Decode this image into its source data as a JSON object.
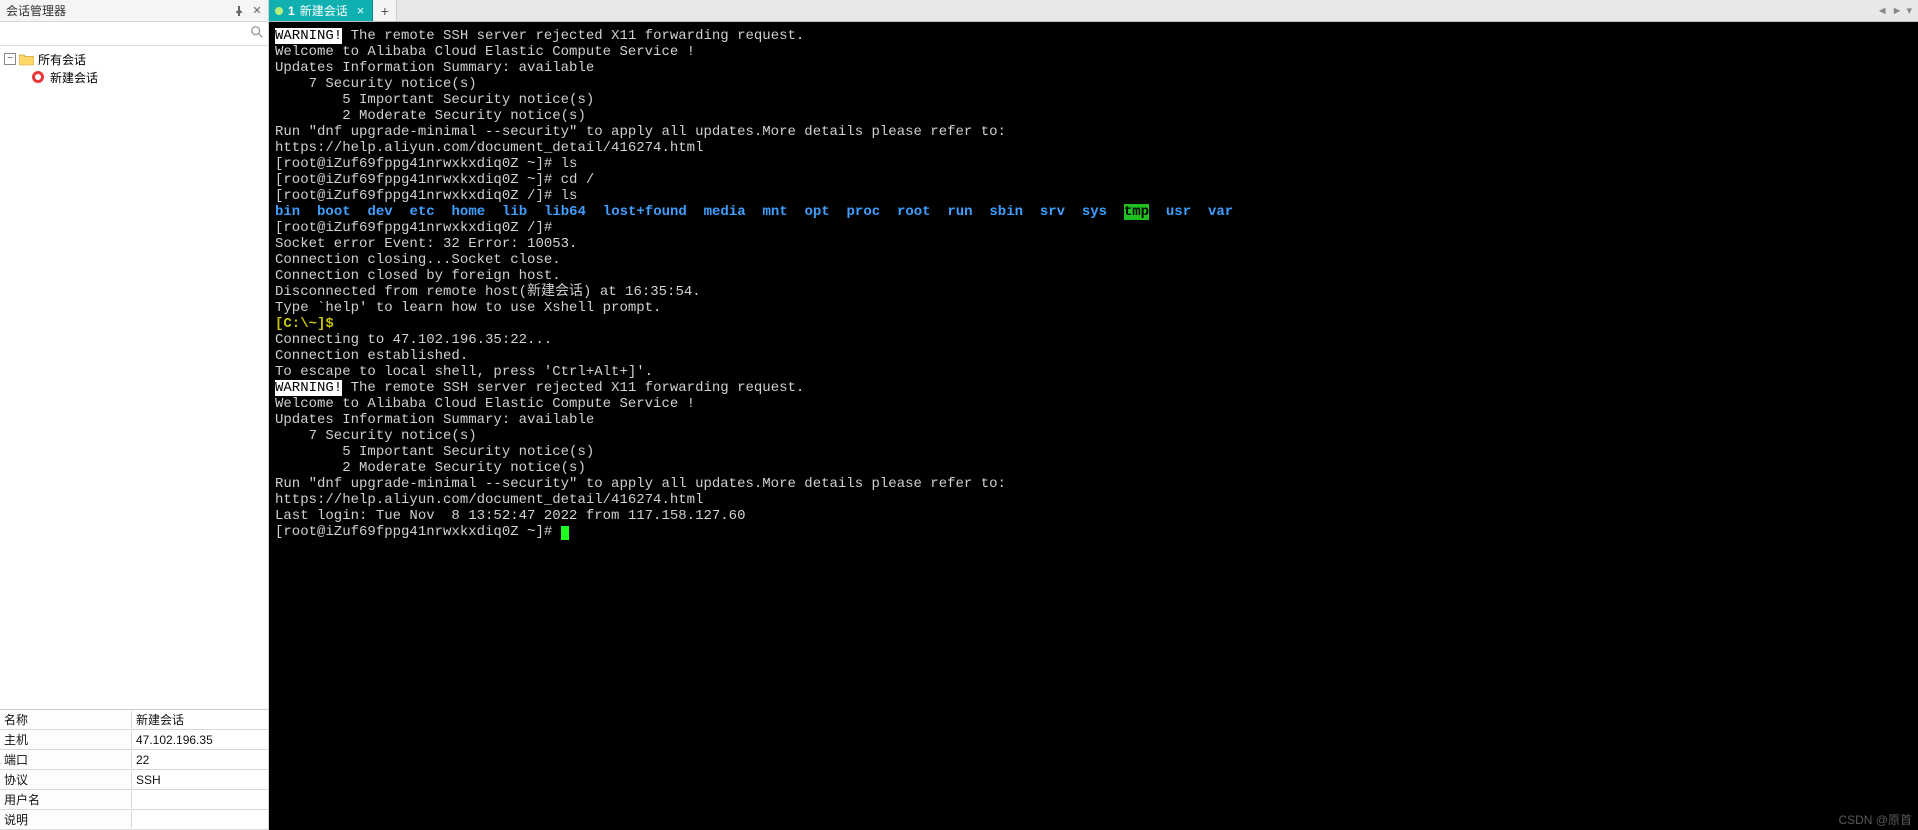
{
  "sidebar": {
    "title": "会话管理器",
    "tree": {
      "root_label": "所有会话",
      "child_label": "新建会话"
    },
    "search_placeholder": ""
  },
  "properties": [
    {
      "key": "名称",
      "val": "新建会话"
    },
    {
      "key": "主机",
      "val": "47.102.196.35"
    },
    {
      "key": "端口",
      "val": "22"
    },
    {
      "key": "协议",
      "val": "SSH"
    },
    {
      "key": "用户名",
      "val": ""
    },
    {
      "key": "说明",
      "val": ""
    }
  ],
  "tabs": {
    "active": {
      "index": "1",
      "label": "新建会话"
    }
  },
  "terminal": {
    "warning_badge": "WARNING!",
    "warning_text": " The remote SSH server rejected X11 forwarding request.",
    "welcome": "Welcome to Alibaba Cloud Elastic Compute Service !",
    "updates_header": "Updates Information Summary: available",
    "updates_l1": "    7 Security notice(s)",
    "updates_l2": "        5 Important Security notice(s)",
    "updates_l3": "        2 Moderate Security notice(s)",
    "run_line": "Run \"dnf upgrade-minimal --security\" to apply all updates.More details please refer to:",
    "help_url": "https://help.aliyun.com/document_detail/416274.html",
    "prompt_home": "[root@iZuf69fppg41nrwxkxdiq0Z ~]#",
    "prompt_root": "[root@iZuf69fppg41nrwxkxdiq0Z /]#",
    "cmd_ls": "ls",
    "cmd_cd": "cd /",
    "dirs_blue_pre": [
      "bin",
      "boot",
      "dev",
      "etc",
      "home",
      "lib",
      "lib64",
      "lost+found",
      "media",
      "mnt",
      "opt",
      "proc",
      "root",
      "run",
      "sbin",
      "srv",
      "sys"
    ],
    "dir_tmp": "tmp",
    "dirs_blue_post": [
      "usr",
      "var"
    ],
    "socket_err": "Socket error Event: 32 Error: 10053.",
    "closing": "Connection closing...Socket close.",
    "closed": "Connection closed by foreign host.",
    "disconnected": "Disconnected from remote host(新建会话) at 16:35:54.",
    "type_help": "Type `help' to learn how to use Xshell prompt.",
    "local_prompt": "[C:\\~]$",
    "connecting": "Connecting to 47.102.196.35:22...",
    "established": "Connection established.",
    "escape": "To escape to local shell, press 'Ctrl+Alt+]'.",
    "last_login": "Last login: Tue Nov  8 13:52:47 2022 from 117.158.127.60"
  },
  "watermark": "CSDN @原首"
}
